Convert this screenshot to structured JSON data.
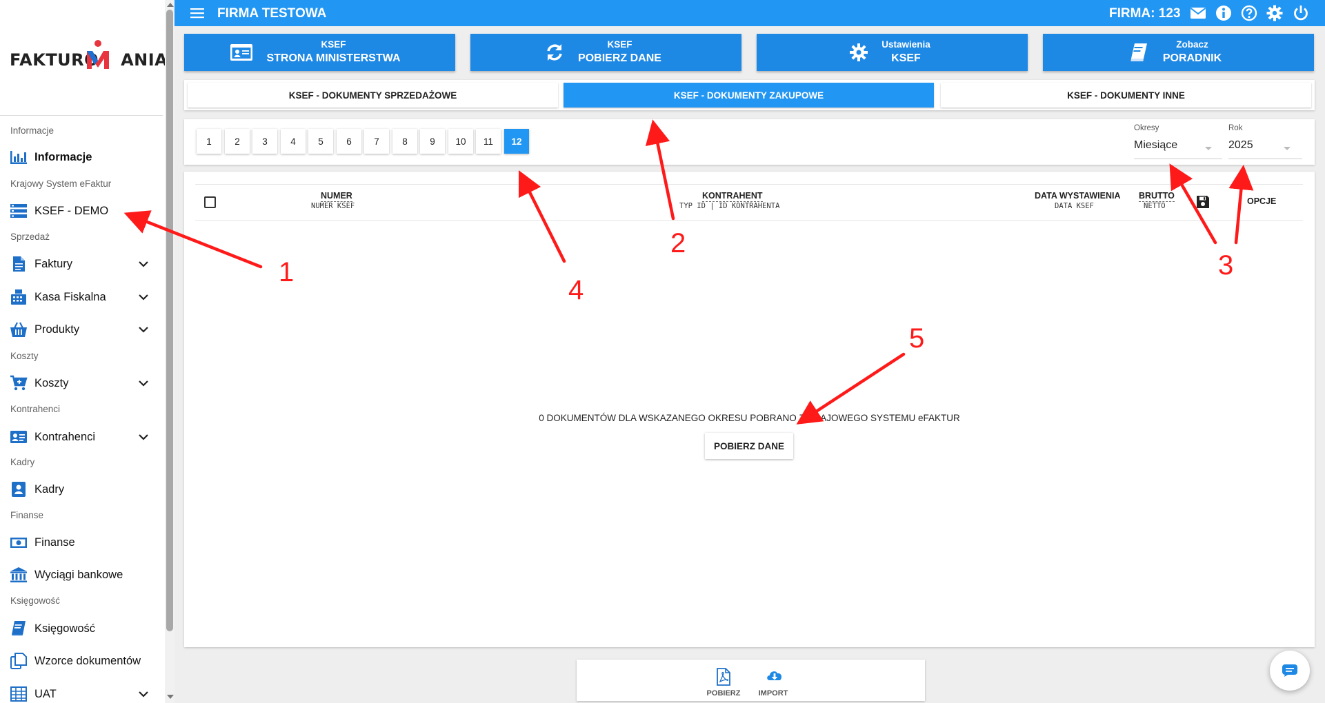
{
  "logo": {
    "text": "FAKTUROMANIA",
    "part1": "FAKTURO",
    "part2": "ANIA"
  },
  "sidebar": {
    "sections": [
      "Informacje",
      "Krajowy System eFaktur",
      "Sprzedaż",
      "Koszty",
      "Kontrahenci",
      "Kadry",
      "Finanse",
      "Księgowość"
    ],
    "items": [
      {
        "label": "Informacje",
        "icon": "bar-chart-icon"
      },
      {
        "label": "KSEF - DEMO",
        "icon": "server-list-icon"
      },
      {
        "label": "Faktury",
        "icon": "document-icon"
      },
      {
        "label": "Kasa Fiskalna",
        "icon": "cash-register-icon"
      },
      {
        "label": "Produkty",
        "icon": "basket-icon"
      },
      {
        "label": "Koszty",
        "icon": "cart-icon"
      },
      {
        "label": "Kontrahenci",
        "icon": "contact-card-icon"
      },
      {
        "label": "Kadry",
        "icon": "person-book-icon"
      },
      {
        "label": "Finanse",
        "icon": "banknote-icon"
      },
      {
        "label": "Wyciągi bankowe",
        "icon": "bank-icon"
      },
      {
        "label": "Księgowość",
        "icon": "ledger-icon"
      },
      {
        "label": "Wzorce dokumentów",
        "icon": "copy-icon"
      },
      {
        "label": "UAT",
        "icon": "grid-table-icon"
      }
    ]
  },
  "topbar": {
    "company": "FIRMA TESTOWA",
    "firma": "FIRMA: 123",
    "icons": [
      "mail-icon",
      "info-icon",
      "help-icon",
      "gear-icon",
      "power-icon"
    ],
    "color": "#2196f3"
  },
  "cards": [
    {
      "top": "KSEF",
      "bottom": "STRONA MINISTERSTWA",
      "icon": "id-card-icon"
    },
    {
      "top": "KSEF",
      "bottom": "POBIERZ DANE",
      "icon": "refresh-icon"
    },
    {
      "top": "Ustawienia",
      "bottom": "KSEF",
      "icon": "gear-icon"
    },
    {
      "top": "Zobacz",
      "bottom": "PORADNIK",
      "icon": "book-icon"
    }
  ],
  "tabs": [
    {
      "label": "KSEF - DOKUMENTY SPRZEDAŻOWE",
      "active": false
    },
    {
      "label": "KSEF - DOKUMENTY ZAKUPOWE",
      "active": true
    },
    {
      "label": "KSEF - DOKUMENTY INNE",
      "active": false
    }
  ],
  "pagination": {
    "pages": [
      "1",
      "2",
      "3",
      "4",
      "5",
      "6",
      "7",
      "8",
      "9",
      "10",
      "11",
      "12"
    ],
    "active": "12"
  },
  "filters": {
    "okresy": {
      "label": "Okresy",
      "value": "Miesiące"
    },
    "rok": {
      "label": "Rok",
      "value": "2025"
    }
  },
  "table": {
    "numer": "NUMER",
    "numer_ksef": "NUMER KSEF",
    "kontrahent": "KONTRAHENT",
    "kontrahent_sub": "TYP ID | ID KONTRAHENTA",
    "data_wyst": "DATA WYSTAWIENIA",
    "data_ksef": "DATA KSEF",
    "brutto": "BRUTTO",
    "netto": "NETTO",
    "opcje": "OPCJE"
  },
  "empty": {
    "message": "0 DOKUMENTÓW DLA WSKAZANEGO OKRESU POBRANO Z KRAJOWEGO SYSTEMU eFAKTUR",
    "button": "POBIERZ DANE"
  },
  "bottom": {
    "pobierz": "POBIERZ",
    "import": "IMPORT"
  },
  "annotations": [
    "1",
    "2",
    "3",
    "4",
    "5"
  ],
  "colors": {
    "accent": "#2196f3",
    "card": "#1e88e5",
    "sidebar_icon": "#1e6fc8",
    "annotation": "#ff1a1a"
  }
}
